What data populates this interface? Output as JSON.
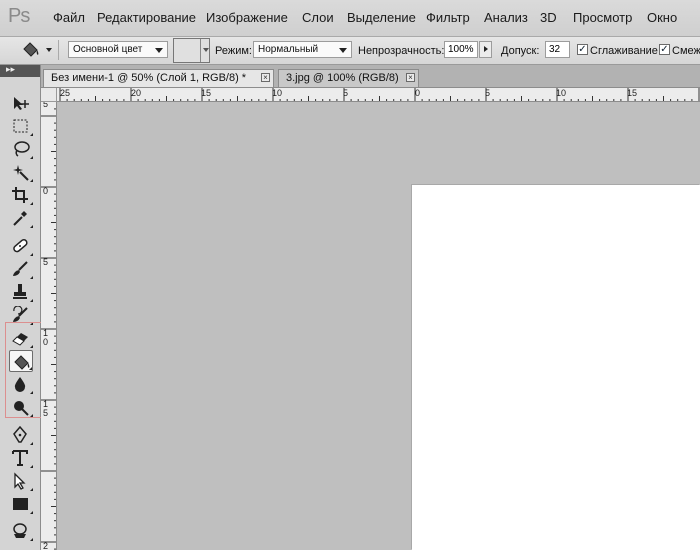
{
  "app": {
    "logo": "Ps"
  },
  "menu": {
    "items": [
      {
        "label": "Файл"
      },
      {
        "label": "Редактирование"
      },
      {
        "label": "Изображение"
      },
      {
        "label": "Слои"
      },
      {
        "label": "Выделение"
      },
      {
        "label": "Фильтр"
      },
      {
        "label": "Анализ"
      },
      {
        "label": "3D"
      },
      {
        "label": "Просмотр"
      },
      {
        "label": "Окно"
      }
    ]
  },
  "options": {
    "fill_source": "Основной цвет",
    "mode_label": "Режим:",
    "mode_value": "Нормальный",
    "opacity_label": "Непрозрачность:",
    "opacity_value": "100%",
    "tolerance_label": "Допуск:",
    "tolerance_value": "32",
    "antialias_label": "Сглаживание",
    "antialias_checked": true,
    "contiguous_label": "Смеж.",
    "contiguous_checked": true
  },
  "tabs": [
    {
      "label": "Без имени-1 @ 50% (Слой 1, RGB/8) *",
      "active": true
    },
    {
      "label": "3.jpg @ 100% (RGB/8)",
      "active": false
    }
  ],
  "ruler_h": [
    "25",
    "20",
    "15",
    "10",
    "5",
    "0",
    "5",
    "10",
    "15"
  ],
  "ruler_v": [
    "5",
    "0",
    "5",
    "1\n0",
    "1\n5",
    "2"
  ],
  "tools": [
    {
      "icon": "move-tool-icon"
    },
    {
      "icon": "marquee-tool-icon"
    },
    {
      "icon": "lasso-tool-icon"
    },
    {
      "icon": "magic-wand-tool-icon"
    },
    {
      "icon": "crop-tool-icon"
    },
    {
      "icon": "eyedropper-tool-icon"
    },
    {
      "icon": "healing-brush-tool-icon"
    },
    {
      "icon": "brush-tool-icon"
    },
    {
      "icon": "clone-stamp-tool-icon"
    },
    {
      "icon": "history-brush-tool-icon"
    },
    {
      "icon": "eraser-tool-icon"
    },
    {
      "icon": "paint-bucket-tool-icon"
    },
    {
      "icon": "blur-tool-icon"
    },
    {
      "icon": "dodge-tool-icon"
    },
    {
      "icon": "pen-tool-icon"
    },
    {
      "icon": "type-tool-icon"
    },
    {
      "icon": "path-selection-tool-icon"
    },
    {
      "icon": "rectangle-tool-icon"
    },
    {
      "icon": "3d-rotate-tool-icon"
    }
  ],
  "colors": {
    "canvas_bg": "#bfbfbf",
    "document": "#ffffff",
    "group_outline": "#dc8f8f"
  }
}
